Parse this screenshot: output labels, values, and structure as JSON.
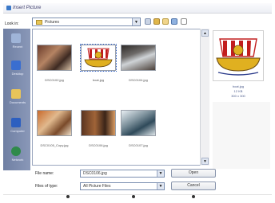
{
  "window": {
    "title": "Insert Picture"
  },
  "toolbar": {
    "lookin_label": "Look in:",
    "lookin_value": "Pictures"
  },
  "sidebar": {
    "items": [
      {
        "label": "Recent",
        "icon": "clock-icon"
      },
      {
        "label": "Desktop",
        "icon": "desktop-icon"
      },
      {
        "label": "Documents",
        "icon": "folder-icon"
      },
      {
        "label": "Computer",
        "icon": "computer-icon"
      },
      {
        "label": "Network",
        "icon": "globe-icon"
      }
    ]
  },
  "files": [
    {
      "name": "DSC0102.jpg"
    },
    {
      "name": "boat.jpg"
    },
    {
      "name": "DSC0104.jpg"
    },
    {
      "name": "DSC0105_Copy.jpg"
    },
    {
      "name": "DSC0106.jpg"
    },
    {
      "name": "DSC0107.jpg"
    }
  ],
  "preview": {
    "name": "boat.jpg",
    "size": "12 KB",
    "dimensions": "300 x 300"
  },
  "form": {
    "filename_label": "File name:",
    "filename_value": "DSC0106.jpg",
    "filetype_label": "Files of type:",
    "filetype_value": "All Picture Files",
    "open_label": "Open",
    "cancel_label": "Cancel"
  },
  "colors": {
    "sidebar": "#7b8aab",
    "accent": "#2b5bc0"
  }
}
